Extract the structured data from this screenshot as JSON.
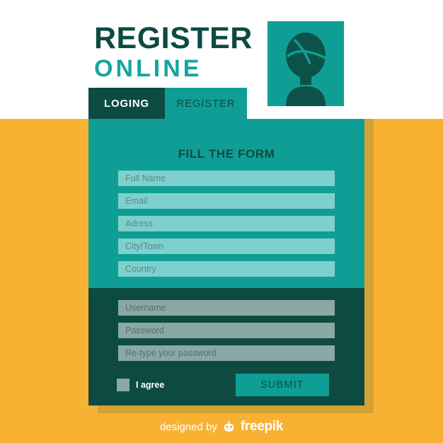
{
  "header": {
    "title_line1": "REGISTER",
    "title_line2": "ONLINE",
    "avatar_icon": "user-avatar-icon"
  },
  "tabs": [
    {
      "label": "LOGING",
      "active": true
    },
    {
      "label": "REGISTER",
      "active": false
    }
  ],
  "form": {
    "title": "FILL THE FORM",
    "light_fields": [
      {
        "placeholder": "Full Name",
        "name": "full-name-input"
      },
      {
        "placeholder": "Email",
        "name": "email-input"
      },
      {
        "placeholder": "Adress",
        "name": "address-input"
      },
      {
        "placeholder": "City/Town",
        "name": "city-town-input"
      },
      {
        "placeholder": "Country",
        "name": "country-input"
      }
    ],
    "dark_fields": [
      {
        "placeholder": "Username",
        "name": "username-input"
      },
      {
        "placeholder": "Password",
        "name": "password-input"
      },
      {
        "placeholder": "Re-type your password",
        "name": "confirm-password-input"
      }
    ],
    "agree_label": "I agree",
    "submit_label": "SUBMIT"
  },
  "footer": {
    "text": "designed by",
    "brand": "freepik",
    "logo_icon": "freepik-mascot-icon"
  },
  "colors": {
    "orange": "#f8b233",
    "gold_shadow": "#d3a233",
    "teal": "#0f9e95",
    "dark_teal": "#0d4a42",
    "light_field": "#7ed0cc",
    "dark_field": "#8aa8a4",
    "title_accent": "#15a79c"
  }
}
